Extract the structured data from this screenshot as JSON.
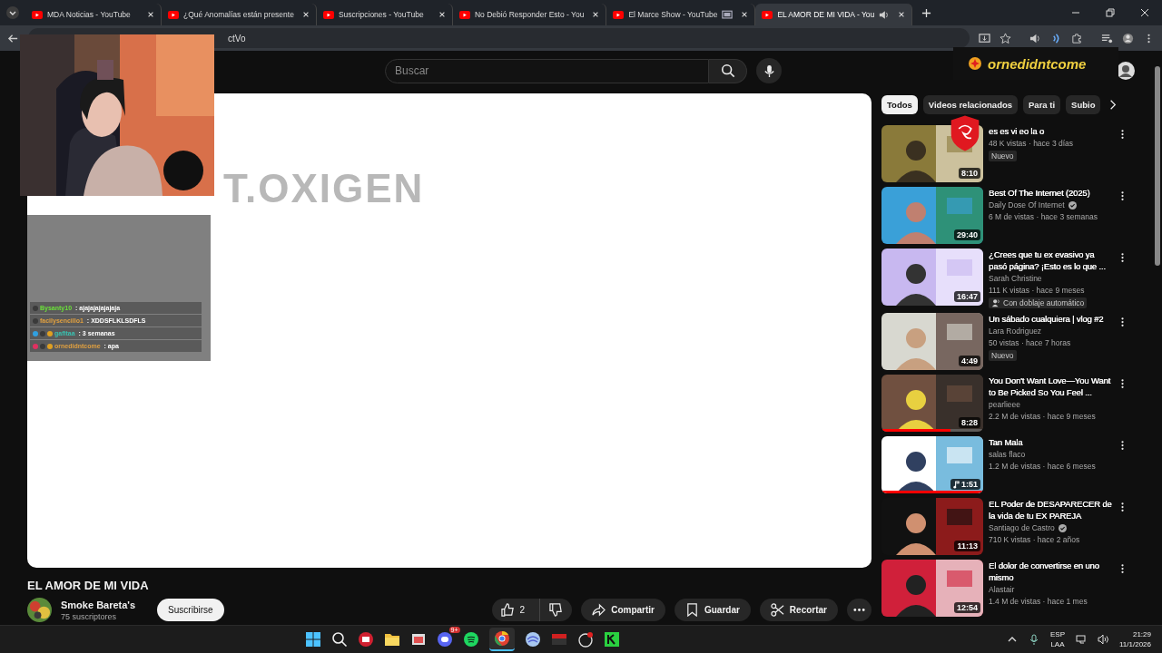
{
  "browser": {
    "tabs": [
      {
        "title": "MDA Noticias - YouTube",
        "selected": false,
        "kind": "plain"
      },
      {
        "title": "¿Qué Anomalías están presente",
        "selected": false,
        "kind": "plain"
      },
      {
        "title": "Suscripciones - YouTube",
        "selected": false,
        "kind": "plain"
      },
      {
        "title": "No Debió Responder Esto - You",
        "selected": false,
        "kind": "plain"
      },
      {
        "title": "El Marce Show - YouTube",
        "selected": false,
        "kind": "cast"
      },
      {
        "title": "EL AMOR DE MI VIDA - You",
        "selected": true,
        "kind": "audio"
      }
    ],
    "address": "ctVo"
  },
  "search": {
    "placeholder": "Buscar"
  },
  "stream_overlay": {
    "video_text": "T.OXIGEN",
    "username_badge": "ornedidntcome",
    "chat": [
      {
        "user": "Bysanty10",
        "message": ": ajajajajajajaja",
        "color": "#6be03a",
        "badges": [
          {
            "color": "#3a3a3a"
          }
        ]
      },
      {
        "user": "facilysencillo1",
        "message": ": XDDSFLKLSDFLS",
        "color": "#e0a040",
        "badges": [
          {
            "color": "#3a3a3a"
          }
        ]
      },
      {
        "user": "gafitaa",
        "message": ": 3 semanas",
        "color": "#3ac0b0",
        "badges": [
          {
            "color": "#30a0e0"
          },
          {
            "color": "#3a3a3a"
          },
          {
            "color": "#e0a020"
          }
        ]
      },
      {
        "user": "ornedidntcome",
        "message": ": apa",
        "color": "#e0a040",
        "badges": [
          {
            "color": "#e03060"
          },
          {
            "color": "#3a3a3a"
          },
          {
            "color": "#e0a020"
          }
        ]
      }
    ]
  },
  "chips": [
    {
      "label": "Todos",
      "selected": true
    },
    {
      "label": "Videos relacionados",
      "selected": false
    },
    {
      "label": "Para ti",
      "selected": false
    },
    {
      "label": "Subio",
      "selected": false
    }
  ],
  "related": [
    {
      "title": "es   es   vi eo   la  o",
      "meta": "48 K vistas · hace 3 días",
      "badge": {
        "label": "Nuevo",
        "kind": "new"
      },
      "duration": "8:10",
      "kind": "video"
    },
    {
      "title": "Best Of The Internet (2025)",
      "channel": "Daily Dose Of Internet",
      "verified": true,
      "meta": "6 M de vistas · hace 3 semanas",
      "duration": "29:40",
      "kind": "video"
    },
    {
      "title": "¿Crees que tu ex evasivo ya pasó página? ¡Esto es lo que ...",
      "channel": "Sarah Christine",
      "verified": false,
      "meta": "111 K vistas · hace 9 meses",
      "badge": {
        "label": "Con doblaje automático",
        "kind": "dubbed"
      },
      "duration": "16:47",
      "kind": "video"
    },
    {
      "title": "Un sábado cualquiera | vlog #2",
      "channel": "Lara Rodriguez",
      "verified": false,
      "meta": "50 vistas · hace 7 horas",
      "badge": {
        "label": "Nuevo",
        "kind": "new"
      },
      "duration": "4:49",
      "kind": "video"
    },
    {
      "title": "You Don't Want Love—You Want to Be Picked So You Feel ...",
      "channel": "pearlieee",
      "verified": false,
      "meta": "2.2 M de vistas · hace 9 meses",
      "duration": "8:28",
      "kind": "video",
      "level": 0.68
    },
    {
      "title": "Tan Mala",
      "channel": "salas flaco",
      "verified": false,
      "meta": "1.2 M de vistas · hace 6 meses",
      "duration": "1:51",
      "kind": "music",
      "level": 1
    },
    {
      "title": "EL Poder de DESAPARECER de la vida de tu EX PAREJA",
      "channel": "Santiago de Castro",
      "verified": true,
      "meta": "710 K vistas · hace 2 años",
      "duration": "11:13",
      "kind": "video"
    },
    {
      "title": "El dolor de convertirse en uno mismo",
      "channel": "Alastair",
      "verified": false,
      "meta": "1.4 M de vistas · hace 1 mes",
      "duration": "12:54",
      "kind": "video"
    }
  ],
  "video": {
    "title": "EL AMOR DE MI VIDA",
    "channel": "Smoke Bareta's",
    "subscribers": "75 suscriptores",
    "subscribe": "Suscribirse",
    "likes": "2",
    "share": "Compartir",
    "save": "Guardar",
    "clip": "Recortar"
  },
  "taskbar": {
    "discord_badge": "9+",
    "language": "ESP",
    "layout": "LAA",
    "time": "21:29",
    "date": "11/1/2026"
  }
}
